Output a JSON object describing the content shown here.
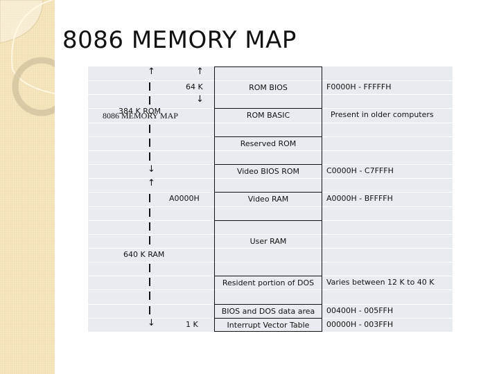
{
  "title": "8086 MEMORY MAP",
  "left_annotations": {
    "size_64k": "64 K",
    "size_384k_rom": "384 K   ROM",
    "overlay_title": "8086 MEMORY MAP",
    "addr_a0000": "A0000H",
    "size_640k_ram": "640 K   RAM",
    "size_1k": "1 K"
  },
  "memory_blocks": [
    {
      "label": "ROM BIOS",
      "address": "F0000H - FFFFFH"
    },
    {
      "label": "ROM BASIC",
      "address": "Present in older computers"
    },
    {
      "label": "Reserved ROM",
      "address": ""
    },
    {
      "label": "Video BIOS ROM",
      "address": "C0000H - C7FFFH"
    },
    {
      "label": "Video RAM",
      "address": "A0000H - BFFFFH"
    },
    {
      "label": "User RAM",
      "address": ""
    },
    {
      "label": "Resident portion of DOS",
      "address": "Varies between 12 K to 40 K"
    },
    {
      "label": "BIOS and DOS data area",
      "address": "00400H - 005FFH"
    },
    {
      "label": "Interrupt Vector Table",
      "address": "00000H - 003FFH"
    }
  ],
  "icons": {
    "up": "↑",
    "down": "↓"
  }
}
